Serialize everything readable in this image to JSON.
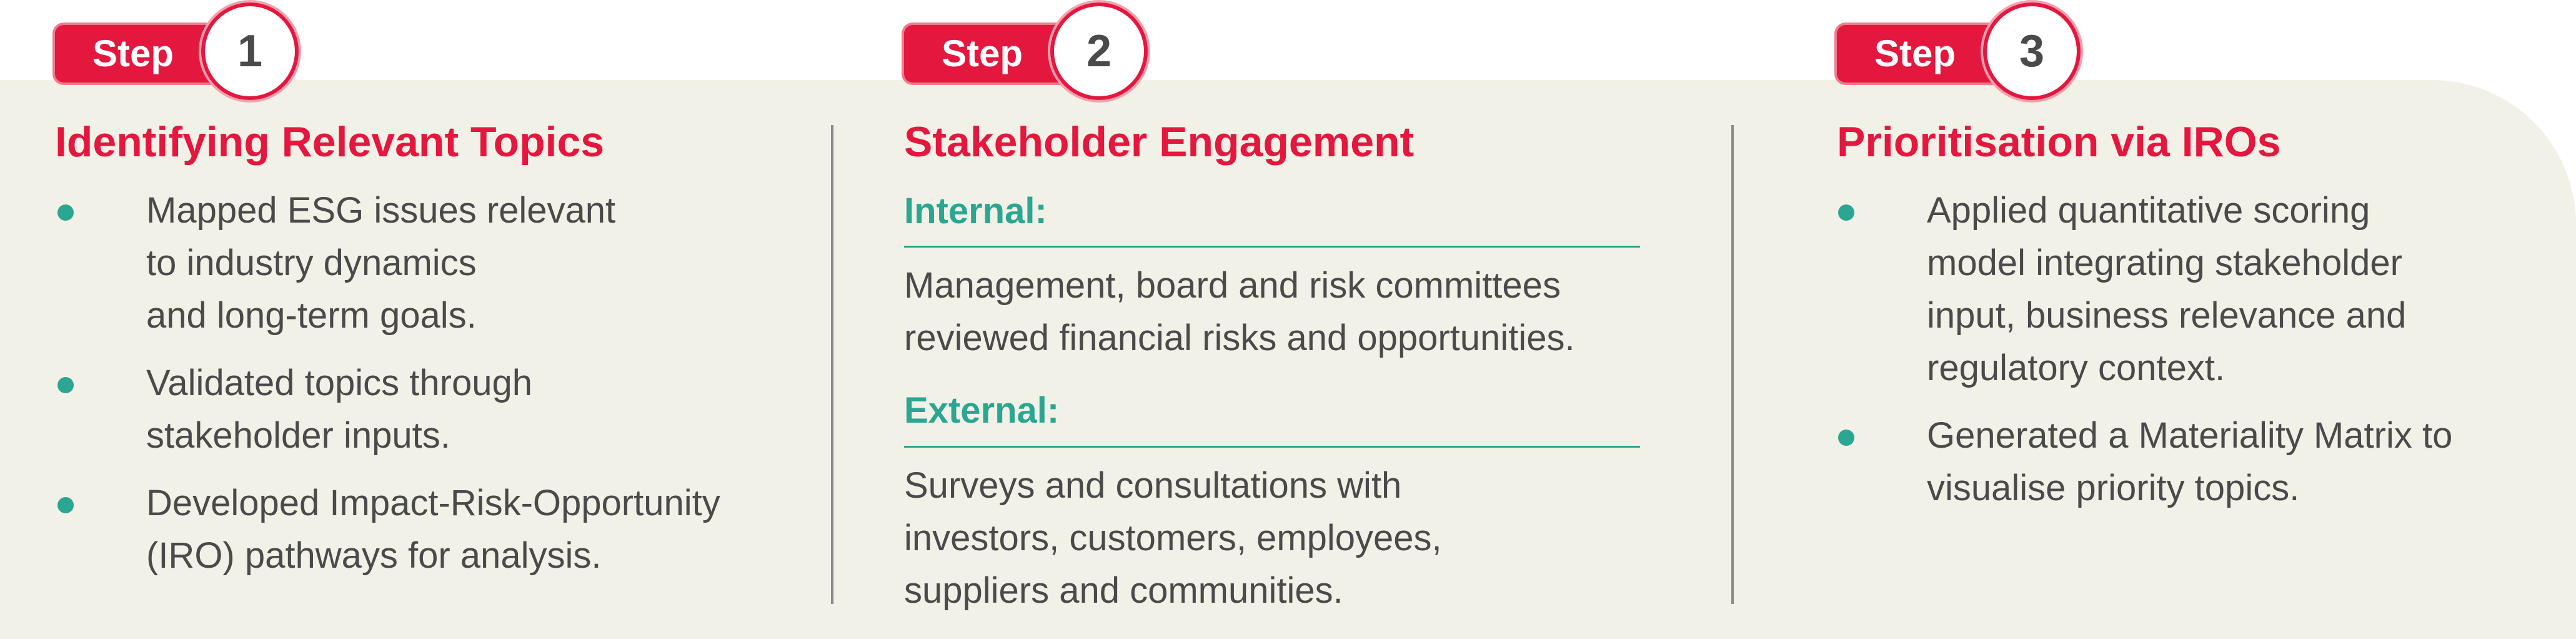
{
  "steps": [
    {
      "badge_label": "Step",
      "number": "1",
      "heading": "Identifying Relevant Topics",
      "bullets": [
        [
          "Mapped ESG issues relevant",
          "to industry dynamics",
          "and long-term goals."
        ],
        [
          "Validated topics through",
          "stakeholder inputs."
        ],
        [
          "Developed Impact-Risk-Opportunity",
          "(IRO) pathways for analysis."
        ]
      ]
    },
    {
      "badge_label": "Step",
      "number": "2",
      "heading": "Stakeholder Engagement",
      "internal_label": "Internal:",
      "internal_text": [
        "Management, board and risk committees",
        "reviewed financial risks and opportunities."
      ],
      "external_label": "External:",
      "external_text": [
        "Surveys and consultations with",
        "investors, customers, employees,",
        "suppliers and communities."
      ]
    },
    {
      "badge_label": "Step",
      "number": "3",
      "heading": "Prioritisation via IROs",
      "bullets": [
        [
          "Applied quantitative scoring",
          "model integrating stakeholder",
          "input, business relevance and",
          "regulatory context."
        ],
        [
          "Generated a Materiality Matrix to",
          "visualise priority topics."
        ]
      ]
    }
  ],
  "colors": {
    "accent_red": "#e4173f",
    "accent_teal": "#2aa692",
    "panel_bg": "#f2f1e7",
    "body_text": "#4a4a4a"
  }
}
